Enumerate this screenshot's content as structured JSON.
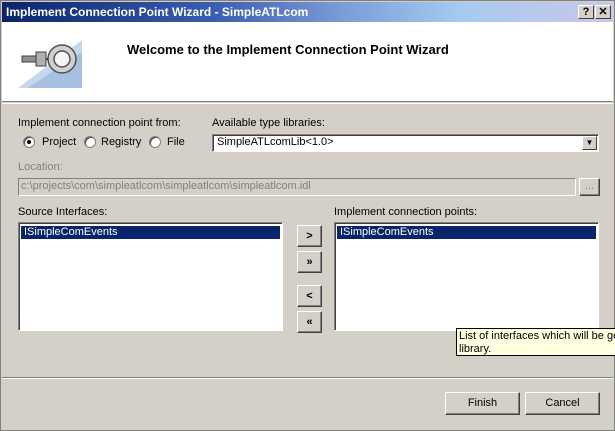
{
  "window": {
    "title": "Implement Connection Point Wizard - SimpleATLcom",
    "help_button": "?",
    "close_button": "✕"
  },
  "header": {
    "welcome": "Welcome to the Implement Connection Point Wizard",
    "icon": "wizard-plug-icon"
  },
  "source": {
    "label": "Implement connection point from:",
    "options": [
      "Project",
      "Registry",
      "File"
    ],
    "selected": "Project"
  },
  "typelibs": {
    "label": "Available type libraries:",
    "value": "SimpleATLcomLib<1.0>"
  },
  "location": {
    "label": "Location:",
    "value": "c:\\projects\\com\\simpleatlcom\\simpleatlcom\\simpleatlcom.idl",
    "browse_label": "..."
  },
  "source_interfaces": {
    "label": "Source Interfaces:",
    "items": [
      "ISimpleComEvents"
    ]
  },
  "implement_points": {
    "label": "Implement connection points:",
    "items": [
      "ISimpleComEvents"
    ]
  },
  "transfer": {
    "add": ">",
    "add_all": "»",
    "remove": "<",
    "remove_all": "«"
  },
  "tooltip": {
    "line1": "List of interfaces which will be ge",
    "line2": "library."
  },
  "buttons": {
    "finish": "Finish",
    "cancel": "Cancel"
  }
}
